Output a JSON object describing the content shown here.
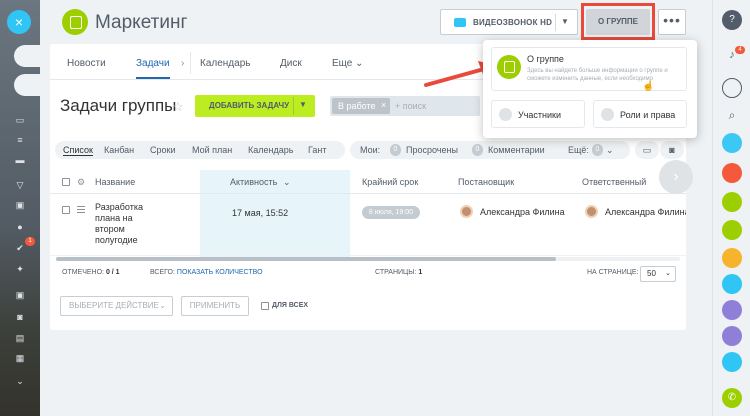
{
  "header": {
    "group_title": "Маркетинг",
    "video_call_label": "ВИДЕОЗВОНОК HD",
    "about_group_label": "О ГРУППЕ",
    "more_label": "•••"
  },
  "tabs": [
    {
      "label": "Новости"
    },
    {
      "label": "Задачи"
    },
    {
      "label": "Календарь"
    },
    {
      "label": "Диск"
    },
    {
      "label": "Еще"
    }
  ],
  "toolbar": {
    "title": "Задачи группы",
    "add_task_label": "ДОБАВИТЬ ЗАДАЧУ",
    "filter_tag": "В работе",
    "search_placeholder": "+ поиск"
  },
  "views": [
    "Список",
    "Канбан",
    "Сроки",
    "Мой план",
    "Календарь",
    "Гант"
  ],
  "counters": {
    "mine_label": "Мои:",
    "overdue_count": "0",
    "overdue_label": "Просрочены",
    "comments_count": "0",
    "comments_label": "Комментарии",
    "more_label": "Ещё:",
    "more_count": "0"
  },
  "table": {
    "columns": [
      "Название",
      "Активность",
      "Крайний срок",
      "Постановщик",
      "Ответственный"
    ],
    "rows": [
      {
        "name": "Разработка плана на втором полугодие",
        "activity": "17 мая, 15:52",
        "deadline": "8 июля, 19:00",
        "creator": "Александра Филина",
        "responsible": "Александра Филина"
      }
    ]
  },
  "footer": {
    "selected_label": "ОТМЕЧЕНО:",
    "selected_value": "0 / 1",
    "total_label": "ВСЕГО:",
    "total_link": "ПОКАЗАТЬ КОЛИЧЕСТВО",
    "pages_label": "СТРАНИЦЫ:",
    "pages_value": "1",
    "per_page_label": "НА СТРАНИЦЕ:",
    "per_page_value": "50",
    "action_placeholder": "ВЫБЕРИТЕ ДЕЙСТВИЕ",
    "apply_label": "ПРИМЕНИТЬ",
    "for_all_label": "ДЛЯ ВСЕХ"
  },
  "popup": {
    "about_title": "О группе",
    "about_desc": "Здесь вы найдете больше информации о группе и сможете изменить данные, если необходимо",
    "members_label": "Участники",
    "roles_label": "Роли и права"
  },
  "left_sidebar": {
    "close_icon": "×",
    "badge": "1"
  },
  "right_sidebar": {
    "notification_badge": "4"
  },
  "colors": {
    "accent_green": "#bbed21",
    "link_blue": "#2067b0",
    "highlight_red": "#e94a3a"
  }
}
